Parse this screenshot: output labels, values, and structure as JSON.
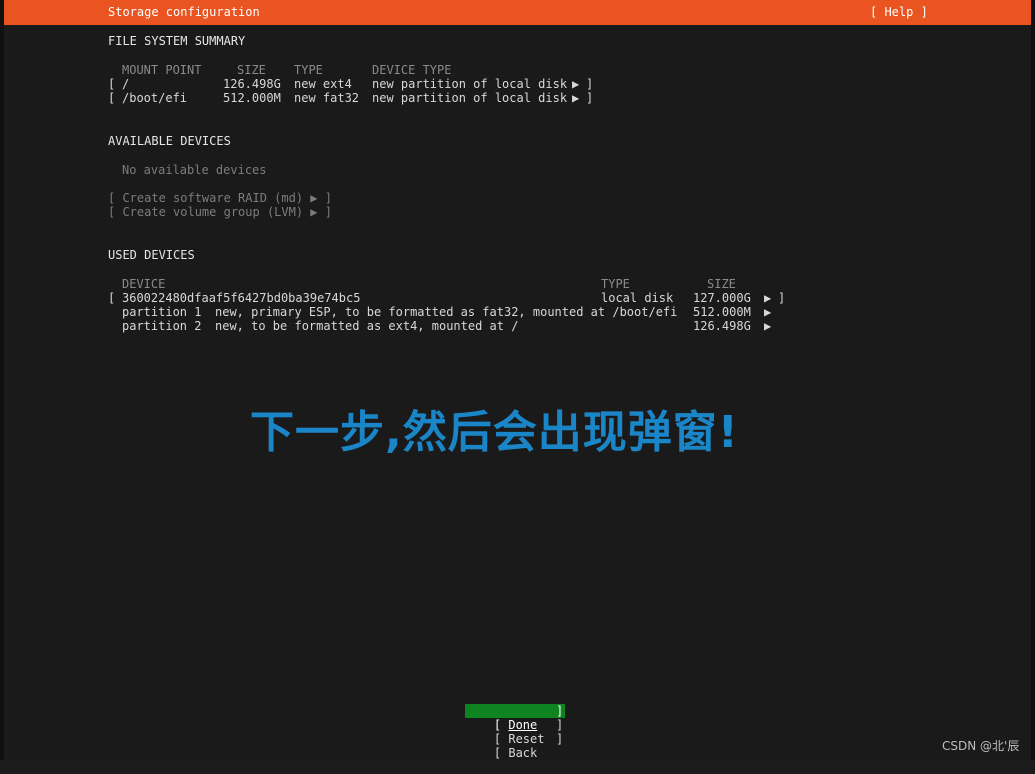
{
  "header": {
    "title": "Storage configuration",
    "help": "[ Help ]"
  },
  "filesystem_summary": {
    "heading": "FILE SYSTEM SUMMARY",
    "columns": {
      "mount_point": "MOUNT POINT",
      "size": "SIZE",
      "type": "TYPE",
      "device_type": "DEVICE TYPE"
    },
    "rows": [
      {
        "open": "[",
        "mount": "/",
        "size": "126.498G",
        "type": "new ext4",
        "device_type": "new partition of local disk",
        "arrow": "▶",
        "close": "]"
      },
      {
        "open": "[",
        "mount": "/boot/efi",
        "size": "512.000M",
        "type": "new fat32",
        "device_type": "new partition of local disk",
        "arrow": "▶",
        "close": "]"
      }
    ]
  },
  "available_devices": {
    "heading": "AVAILABLE DEVICES",
    "empty_text": "No available devices",
    "actions": [
      "[ Create software RAID (md) ▶ ]",
      "[ Create volume group (LVM) ▶ ]"
    ]
  },
  "used_devices": {
    "heading": "USED DEVICES",
    "columns": {
      "device": "DEVICE",
      "type": "TYPE",
      "size": "SIZE"
    },
    "disk": {
      "open": "[",
      "name": "360022480dfaaf5f6427bd0ba39e74bc5",
      "type": "local disk",
      "size": "127.000G",
      "arrow": "▶",
      "close": "]"
    },
    "partitions": [
      {
        "name": "partition 1",
        "desc": "new, primary ESP, to be formatted as fat32, mounted at /boot/efi",
        "size": "512.000M",
        "arrow": "▶"
      },
      {
        "name": "partition 2",
        "desc": "new, to be formatted as ext4, mounted at /",
        "size": "126.498G",
        "arrow": "▶"
      }
    ]
  },
  "overlay_caption": "下一步,然后会出现弹窗!",
  "buttons": {
    "done": {
      "open": "[ ",
      "label": "Done",
      "close": "]"
    },
    "reset": {
      "open": "[ ",
      "label": "Reset",
      "close": "]"
    },
    "back": {
      "open": "[ ",
      "label": "Back",
      "close": "]"
    }
  },
  "watermark": "CSDN @北'辰",
  "colors": {
    "accent": "#e95420",
    "button_active": "#0e8420",
    "caption": "#1a86c8",
    "background": "#1a1a1b"
  }
}
